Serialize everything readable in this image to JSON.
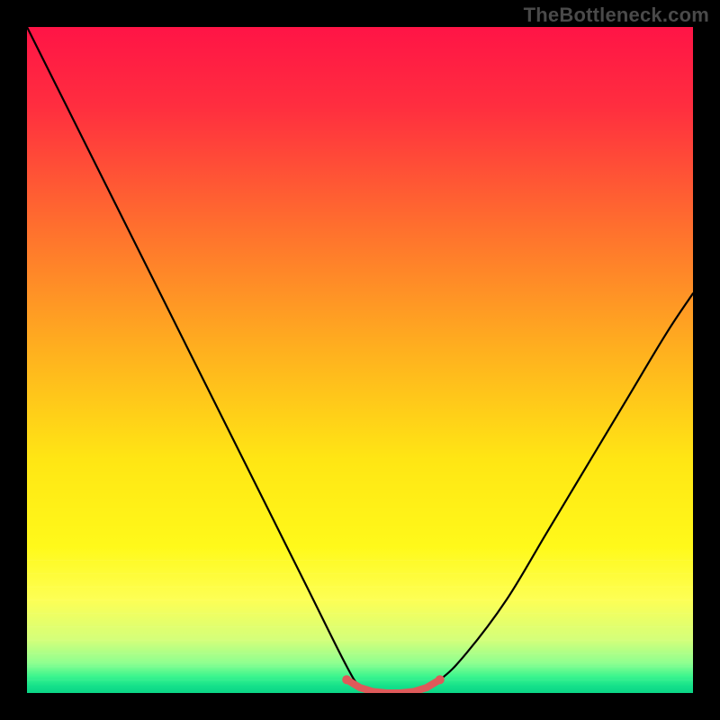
{
  "watermark": "TheBottleneck.com",
  "chart_data": {
    "type": "line",
    "title": "",
    "xlabel": "",
    "ylabel": "",
    "xlim": [
      0,
      100
    ],
    "ylim": [
      0,
      100
    ],
    "series": [
      {
        "name": "bottleneck-curve",
        "x": [
          0,
          6,
          12,
          18,
          24,
          30,
          36,
          42,
          48,
          50,
          52,
          54,
          58,
          62,
          66,
          72,
          78,
          84,
          90,
          96,
          100
        ],
        "y": [
          100,
          88,
          76,
          64,
          52,
          40,
          28,
          16,
          4,
          1,
          0,
          0,
          0,
          2,
          6,
          14,
          24,
          34,
          44,
          54,
          60
        ]
      },
      {
        "name": "trough-markers",
        "x": [
          48,
          50,
          52,
          54,
          56,
          58,
          60,
          62
        ],
        "y": [
          2,
          0.8,
          0.2,
          0,
          0,
          0.2,
          0.8,
          2
        ]
      }
    ],
    "background_gradient": {
      "type": "vertical",
      "stops": [
        {
          "offset": 0.0,
          "color": "#ff1446"
        },
        {
          "offset": 0.12,
          "color": "#ff2e3f"
        },
        {
          "offset": 0.3,
          "color": "#ff6f2e"
        },
        {
          "offset": 0.48,
          "color": "#ffae1f"
        },
        {
          "offset": 0.65,
          "color": "#ffe614"
        },
        {
          "offset": 0.78,
          "color": "#fff91a"
        },
        {
          "offset": 0.86,
          "color": "#fdff55"
        },
        {
          "offset": 0.92,
          "color": "#d4ff7a"
        },
        {
          "offset": 0.955,
          "color": "#8fff90"
        },
        {
          "offset": 0.975,
          "color": "#3cf58e"
        },
        {
          "offset": 0.99,
          "color": "#14e08a"
        },
        {
          "offset": 1.0,
          "color": "#0bd486"
        }
      ]
    }
  }
}
